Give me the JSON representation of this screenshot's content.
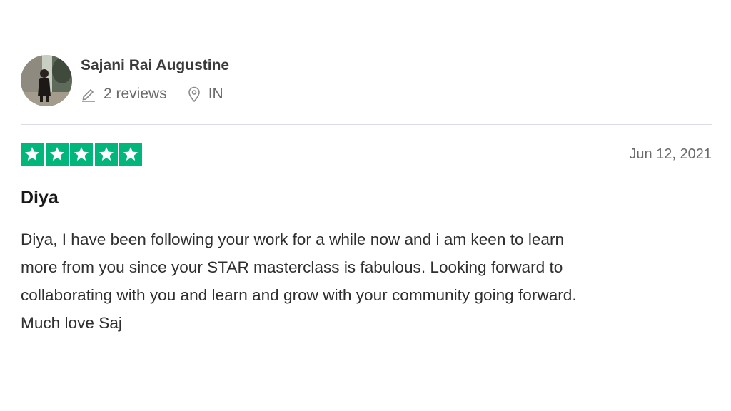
{
  "reviewer": {
    "name": "Sajani Rai Augustine",
    "reviews_count": "2 reviews",
    "country": "IN",
    "avatar_icon": "user-photo"
  },
  "review": {
    "rating": 5,
    "rating_max": 5,
    "star_color": "#00b67a",
    "date": "Jun 12, 2021",
    "title": "Diya",
    "body_lines": [
      "Diya, I have been following your work for a while now and i am keen to learn",
      "more from you since your STAR masterclass is fabulous. Looking forward to",
      "collaborating with you and learn and grow with your community going forward.",
      "Much love Saj"
    ]
  },
  "icons": {
    "reviews": "pencil-icon",
    "location": "location-pin-icon",
    "star": "star-icon"
  }
}
